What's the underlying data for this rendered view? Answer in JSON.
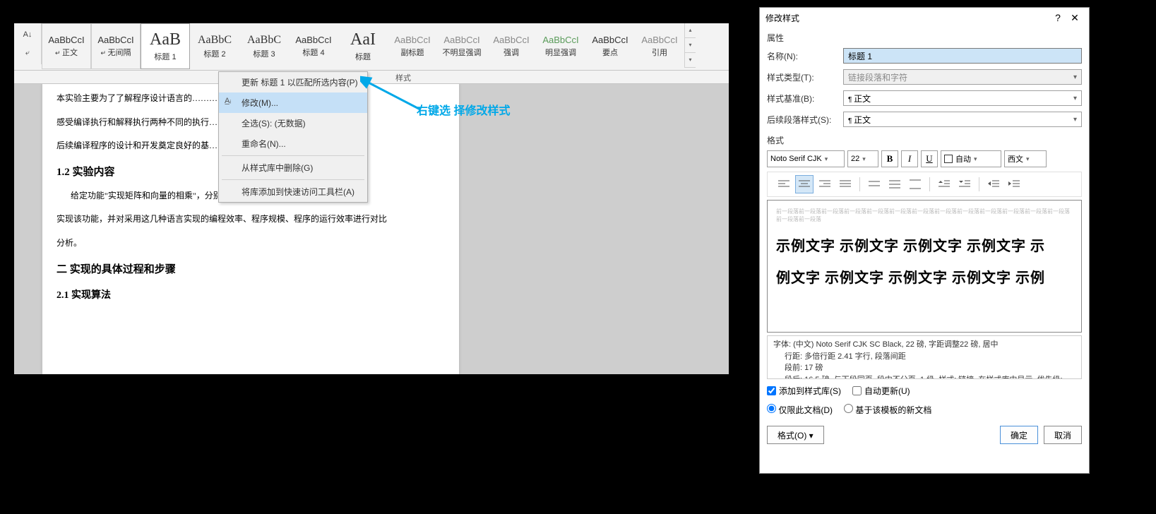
{
  "word": {
    "styles": [
      {
        "preview": "AaBbCcI",
        "name": "正文",
        "cls": "",
        "arrow": true
      },
      {
        "preview": "AaBbCcI",
        "name": "无间隔",
        "cls": "",
        "arrow": true
      },
      {
        "preview": "AaB",
        "name": "标题 1",
        "cls": "big",
        "arrow": false,
        "selected": true
      },
      {
        "preview": "AaBbC",
        "name": "标题 2",
        "cls": "mid",
        "arrow": false
      },
      {
        "preview": "AaBbC",
        "name": "标题 3",
        "cls": "mid",
        "arrow": false
      },
      {
        "preview": "AaBbCcI",
        "name": "标题 4",
        "cls": "",
        "arrow": false
      },
      {
        "preview": "AaI",
        "name": "标题",
        "cls": "big",
        "arrow": false
      },
      {
        "preview": "AaBbCcI",
        "name": "副标题",
        "cls": "gray",
        "arrow": false
      },
      {
        "preview": "AaBbCcI",
        "name": "不明显强调",
        "cls": "gray",
        "arrow": false
      },
      {
        "preview": "AaBbCcI",
        "name": "强调",
        "cls": "gray",
        "arrow": false
      },
      {
        "preview": "AaBbCcI",
        "name": "明显强调",
        "cls": "green",
        "arrow": false
      },
      {
        "preview": "AaBbCcI",
        "name": "要点",
        "cls": "",
        "arrow": false
      },
      {
        "preview": "AaBbCcI",
        "name": "引用",
        "cls": "gray",
        "arrow": false
      }
    ],
    "context_menu": {
      "update": "更新 标题 1 以匹配所选内容(P)",
      "modify": "修改(M)...",
      "select_all": "全选(S): (无数据)",
      "rename": "重命名(N)...",
      "remove": "从样式库中删除(G)",
      "add_qat": "将库添加到快速访问工具栏(A)"
    },
    "styles_label": "样式",
    "doc": {
      "l1": "本实验主要为了了解程序设计语言的……………………………………特点，",
      "l2": "感受编译执行和解释执行两种不同的执行……………………………力，为",
      "l3": "后续编译程序的设计和开发奠定良好的基……",
      "h1": "1.2  实验内容",
      "l4": "给定功能\"实现矩阵和向量的相乘\"，分别使用 C/C++、Java、Python 和 Haskell",
      "l5": "实现该功能，并对采用这几种语言实现的编程效率、程序规模、程序的运行效率进行对比",
      "l6": "分析。",
      "h2": "二  实现的具体过程和步骤",
      "h3": "2.1  实现算法"
    },
    "annotation": "右键选 择修改样式"
  },
  "dialog": {
    "title": "修改样式",
    "section_props": "属性",
    "labels": {
      "name": "名称(N):",
      "type": "样式类型(T):",
      "based": "样式基准(B):",
      "follow": "后续段落样式(S):"
    },
    "values": {
      "name": "标题 1",
      "type": "链接段落和字符",
      "based": "正文",
      "follow": "正文"
    },
    "section_format": "格式",
    "format_bar": {
      "font": "Noto Serif CJK",
      "size": "22",
      "color": "自动",
      "lang": "西文"
    },
    "preview_tiny": "前一段落前一段落前一段落前一段落前一段落前一段落前一段落前一段落前一段落前一段落前一段落前一段落前一段落前一段落前一段落",
    "preview_sample1": "示例文字 示例文字 示例文字 示例文字 示",
    "preview_sample2": "例文字 示例文字 示例文字 示例文字 示例",
    "desc": {
      "l1": "字体: (中文) Noto Serif CJK SC Black, 22 磅, 字距调整22 磅, 居中",
      "l2": "行距: 多倍行距 2.41 字行, 段落间距",
      "l3": "段前: 17 磅",
      "l4": "段后: 16.5 磅, 与下段同页, 段中不分页, 1 级, 样式: 链接, 在样式库中显示, 优先级:"
    },
    "checks": {
      "add_gallery": "添加到样式库(S)",
      "auto_update": "自动更新(U)"
    },
    "radios": {
      "this_doc": "仅限此文档(D)",
      "template": "基于该模板的新文档"
    },
    "buttons": {
      "format": "格式(O) ▾",
      "ok": "确定",
      "cancel": "取消"
    }
  }
}
